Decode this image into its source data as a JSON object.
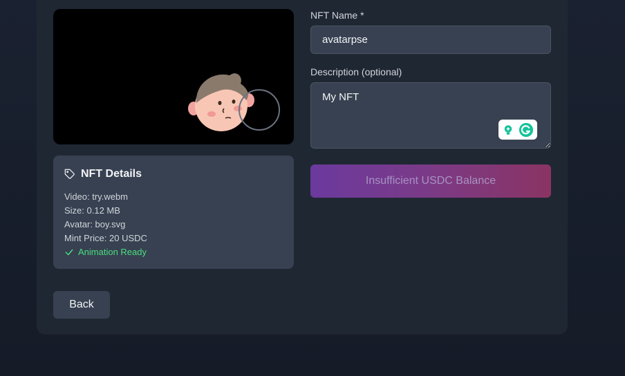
{
  "details": {
    "title": "NFT Details",
    "video": "Video: try.webm",
    "size": "Size: 0.12 MB",
    "avatar": "Avatar: boy.svg",
    "price": "Mint Price: 20 USDC",
    "status": "Animation Ready"
  },
  "form": {
    "name_label": "NFT Name *",
    "name_value": "avatarpse",
    "description_label": "Description (optional)",
    "description_value": "My NFT",
    "submit_label": "Insufficient USDC Balance"
  },
  "back_label": "Back",
  "colors": {
    "background": "#1a2130",
    "card": "#1f2733",
    "panel": "#374151",
    "success": "#4ade80",
    "button_gradient_start": "#6b3a9e",
    "button_gradient_end": "#8a3463"
  },
  "icons": {
    "details": "tag-icon",
    "status": "check-icon",
    "grammarly": "grammarly-icon",
    "suggestion": "lightbulb-icon"
  }
}
